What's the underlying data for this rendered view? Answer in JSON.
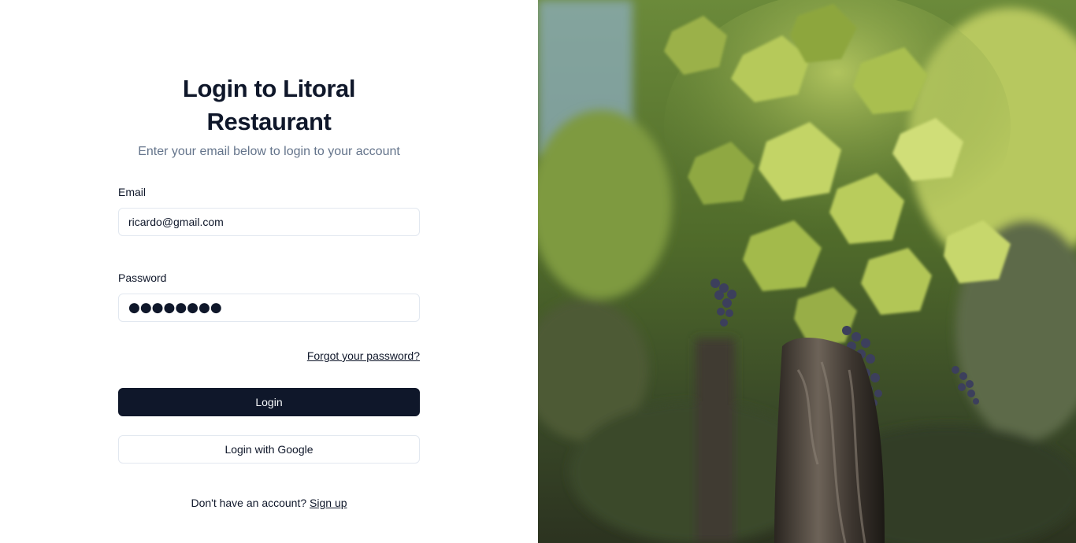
{
  "login": {
    "title": "Login to Litoral Restaurant",
    "subtitle": "Enter your email below to login to your account",
    "email_label": "Email",
    "email_value": "ricardo@gmail.com",
    "password_label": "Password",
    "password_value": "●●●●●●●●",
    "forgot_label": "Forgot your password?",
    "login_button": "Login",
    "google_button": "Login with Google",
    "signup_prompt": "Don't have an account?",
    "signup_link": "Sign up"
  },
  "colors": {
    "primary": "#0f172a",
    "muted_text": "#64748b",
    "border": "#e2e8f0"
  }
}
